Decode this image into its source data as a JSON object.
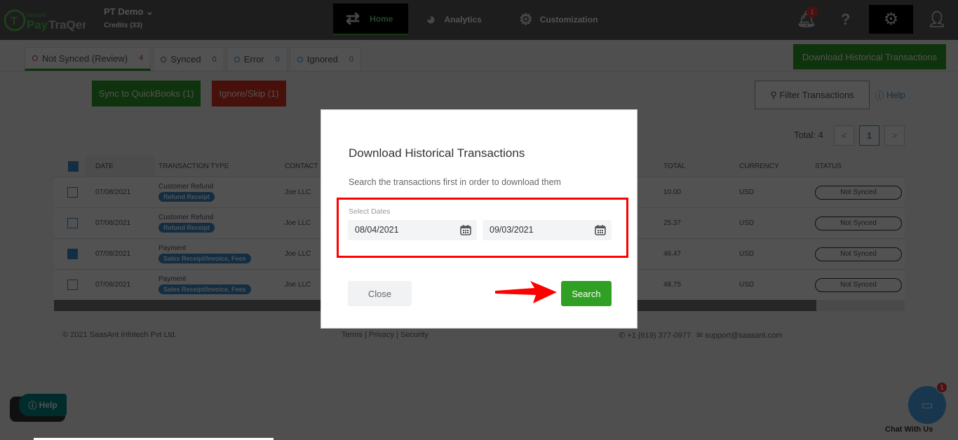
{
  "header": {
    "logo_text": "PayTraQer",
    "logo_brand": "saasant",
    "account": "PT Demo",
    "credits": "Credits (33)",
    "nav": [
      {
        "label": "Home",
        "icon": "arrows-swap-icon"
      },
      {
        "label": "Analytics",
        "icon": "pie-chart-icon"
      },
      {
        "label": "Customization",
        "icon": "gears-icon"
      }
    ],
    "notifications": "1"
  },
  "tabs": [
    {
      "label": "Not Synced (Review)",
      "count": "4",
      "color": "#cc3333"
    },
    {
      "label": "Synced",
      "count": "0",
      "color": "#2c8f2c"
    },
    {
      "label": "Error",
      "count": "0",
      "color": "#3a8fd0"
    },
    {
      "label": "Ignored",
      "count": "0",
      "color": "#3a8fd0"
    }
  ],
  "actions": {
    "download": "Download Historical Transactions",
    "sync": "Sync to QuickBooks (1)",
    "ignore": "Ignore/Skip (1)",
    "filter": "Filter Transactions",
    "help": "Help"
  },
  "pagination": {
    "total": "Total: 4",
    "page": "1",
    "prev": "<",
    "next": ">"
  },
  "table": {
    "headers": [
      "DATE",
      "TRANSACTION TYPE",
      "CONTACT",
      "TOTAL",
      "CURRENCY",
      "STATUS"
    ],
    "rows": [
      {
        "checked": false,
        "date": "07/08/2021",
        "type": "Customer Refund",
        "tag": "Refund Receipt",
        "contact": "Joe LLC",
        "total": "10.00",
        "currency": "USD",
        "status": "Not Synced"
      },
      {
        "checked": false,
        "date": "07/08/2021",
        "type": "Customer Refund",
        "tag": "Refund Receipt",
        "contact": "Joe LLC",
        "total": "25.37",
        "currency": "USD",
        "status": "Not Synced"
      },
      {
        "checked": true,
        "date": "07/08/2021",
        "type": "Payment",
        "tag": "Sales Receipt/Invoice, Fees",
        "contact": "Joe LLC",
        "total": "46.47",
        "currency": "USD",
        "status": "Not Synced"
      },
      {
        "checked": false,
        "date": "07/08/2021",
        "type": "Payment",
        "tag": "Sales Receipt/Invoice, Fees",
        "contact": "Joe LLC",
        "total": "48.75",
        "currency": "USD",
        "status": "Not Synced"
      }
    ]
  },
  "footer": {
    "copyright": "© 2021 SaasAnt Infotech Pvt Ltd.",
    "links": "Terms | Privacy | Security",
    "phone": "+1 (619) 377-0977",
    "email": "support@saasant.com"
  },
  "widgets": {
    "help": "Help",
    "chat": "Chat With Us",
    "chat_badge": "1"
  },
  "modal": {
    "title": "Download Historical Transactions",
    "subtitle": "Search the transactions first in order to download them",
    "dates_label": "Select Dates",
    "start_date": "08/04/2021",
    "end_date": "09/03/2021",
    "close": "Close",
    "search": "Search"
  }
}
